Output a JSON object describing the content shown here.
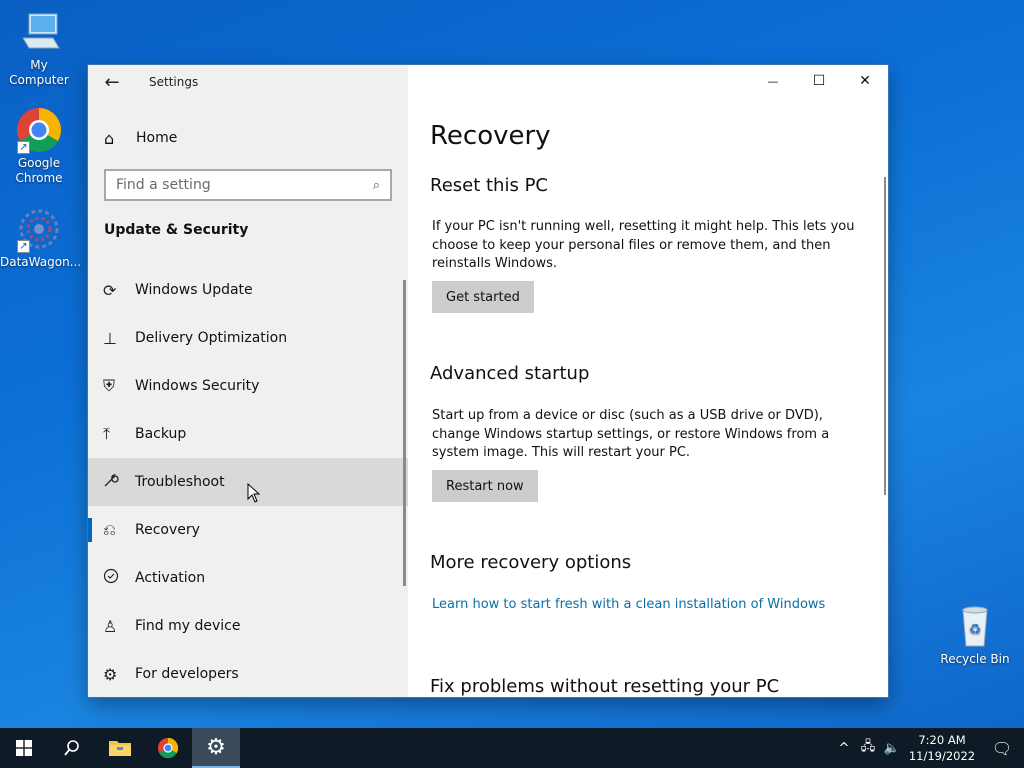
{
  "desktop": {
    "icons": [
      {
        "label": "My Computer"
      },
      {
        "label": "Google Chrome"
      },
      {
        "label": "DataWagon..."
      },
      {
        "label": "Recycle Bin"
      }
    ]
  },
  "window": {
    "app_title": "Settings",
    "back_glyph": "←",
    "controls": {
      "minimize": "—",
      "maximize": "☐",
      "close": "✕"
    }
  },
  "sidebar": {
    "home_label": "Home",
    "search_placeholder": "Find a setting",
    "section_title": "Update & Security",
    "items": [
      {
        "label": "Windows Update",
        "icon": "sync-icon",
        "glyph": "⟳"
      },
      {
        "label": "Delivery Optimization",
        "icon": "delivery-icon",
        "glyph": "⊥"
      },
      {
        "label": "Windows Security",
        "icon": "shield-icon",
        "glyph": "⛨"
      },
      {
        "label": "Backup",
        "icon": "backup-arrow-icon",
        "glyph": "⤒"
      },
      {
        "label": "Troubleshoot",
        "icon": "wrench-icon",
        "glyph": "🔧"
      },
      {
        "label": "Recovery",
        "icon": "recovery-icon",
        "glyph": "⎌"
      },
      {
        "label": "Activation",
        "icon": "check-circle-icon",
        "glyph": "✓"
      },
      {
        "label": "Find my device",
        "icon": "person-pin-icon",
        "glyph": "♙"
      },
      {
        "label": "For developers",
        "icon": "developer-icon",
        "glyph": "⚙"
      }
    ],
    "hover_item": "Troubleshoot",
    "selected_item": "Recovery"
  },
  "content": {
    "title": "Recovery",
    "reset": {
      "heading": "Reset this PC",
      "description": "If your PC isn't running well, resetting it might help. This lets you choose to keep your personal files or remove them, and then reinstalls Windows.",
      "button": "Get started"
    },
    "advanced": {
      "heading": "Advanced startup",
      "description": "Start up from a device or disc (such as a USB drive or DVD), change Windows startup settings, or restore Windows from a system image. This will restart your PC.",
      "button": "Restart now"
    },
    "more": {
      "heading": "More recovery options",
      "link": "Learn how to start fresh with a clean installation of Windows"
    },
    "fix": {
      "heading": "Fix problems without resetting your PC"
    }
  },
  "taskbar": {
    "time": "7:20 AM",
    "date": "11/19/2022"
  },
  "colors": {
    "accent": "#0067c0",
    "link": "#0b6ea8",
    "taskbar": "#0e1a26"
  }
}
